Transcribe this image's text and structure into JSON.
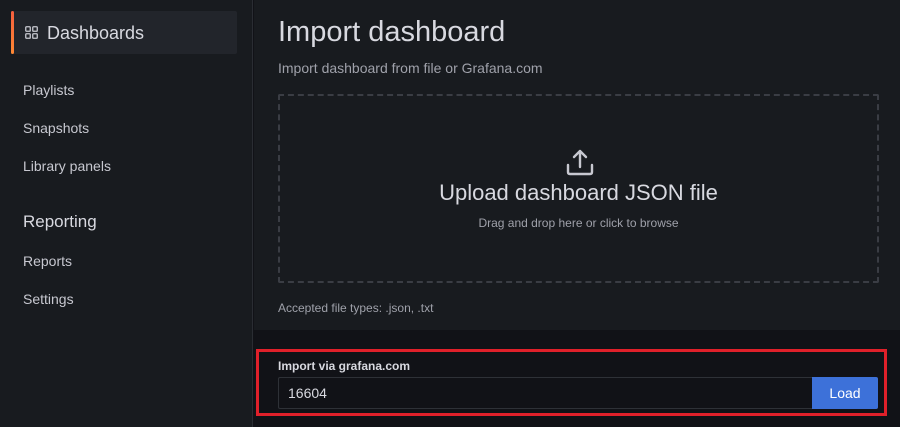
{
  "sidebar": {
    "header_title": "Dashboards",
    "items": [
      {
        "label": "Playlists"
      },
      {
        "label": "Snapshots"
      },
      {
        "label": "Library panels"
      }
    ],
    "section_title": "Reporting",
    "section_items": [
      {
        "label": "Reports"
      },
      {
        "label": "Settings"
      }
    ]
  },
  "main": {
    "title": "Import dashboard",
    "subtitle": "Import dashboard from file or Grafana.com",
    "dropzone": {
      "title": "Upload dashboard JSON file",
      "hint": "Drag and drop here or click to browse"
    },
    "accepted_types": "Accepted file types: .json, .txt",
    "grafana_import": {
      "label": "Import via grafana.com",
      "value": "16604",
      "button_label": "Load"
    }
  },
  "icons": {
    "sidebar_header": "apps-grid-icon",
    "dropzone": "upload-icon"
  },
  "colors": {
    "accent": "#f55f3e",
    "primary_button": "#3d71d9",
    "highlight": "#e0202a"
  }
}
